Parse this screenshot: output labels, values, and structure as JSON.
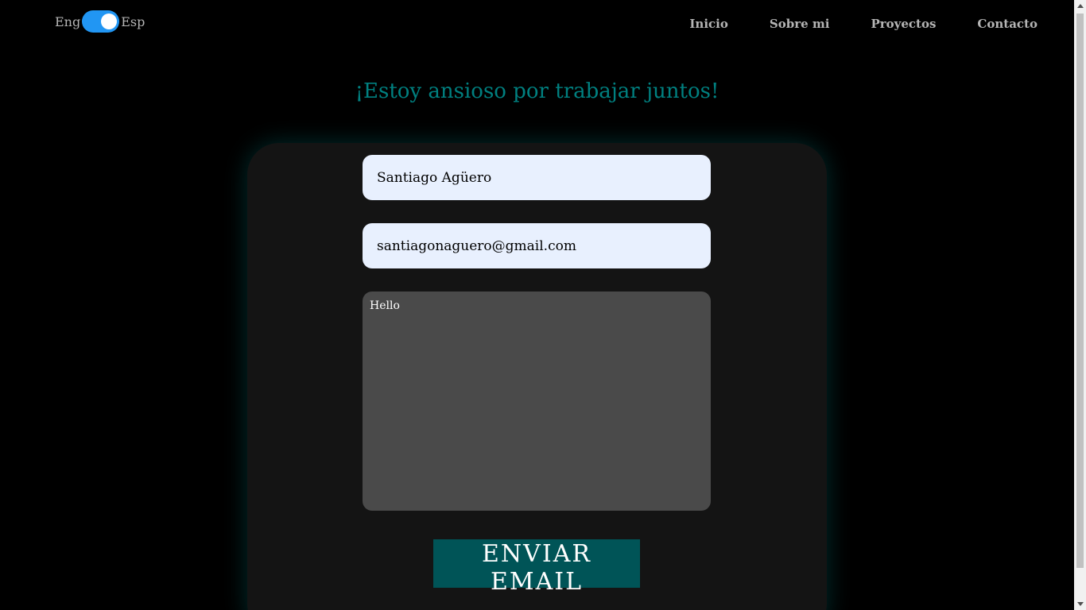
{
  "language_toggle": {
    "left_label": "Eng",
    "right_label": "Esp",
    "selected": "Esp",
    "color": "#2196f3"
  },
  "nav": {
    "items": [
      {
        "label": "Inicio"
      },
      {
        "label": "Sobre mi"
      },
      {
        "label": "Proyectos"
      },
      {
        "label": "Contacto"
      }
    ]
  },
  "heading": "¡Estoy ansioso por trabajar juntos!",
  "form": {
    "name_value": "Santiago Agüero",
    "email_value": "santiagonaguero@gmail.com",
    "message_value": "Hello",
    "submit_label": "ENVIAR EMAIL"
  },
  "colors": {
    "accent": "#008080",
    "button": "#005457"
  }
}
